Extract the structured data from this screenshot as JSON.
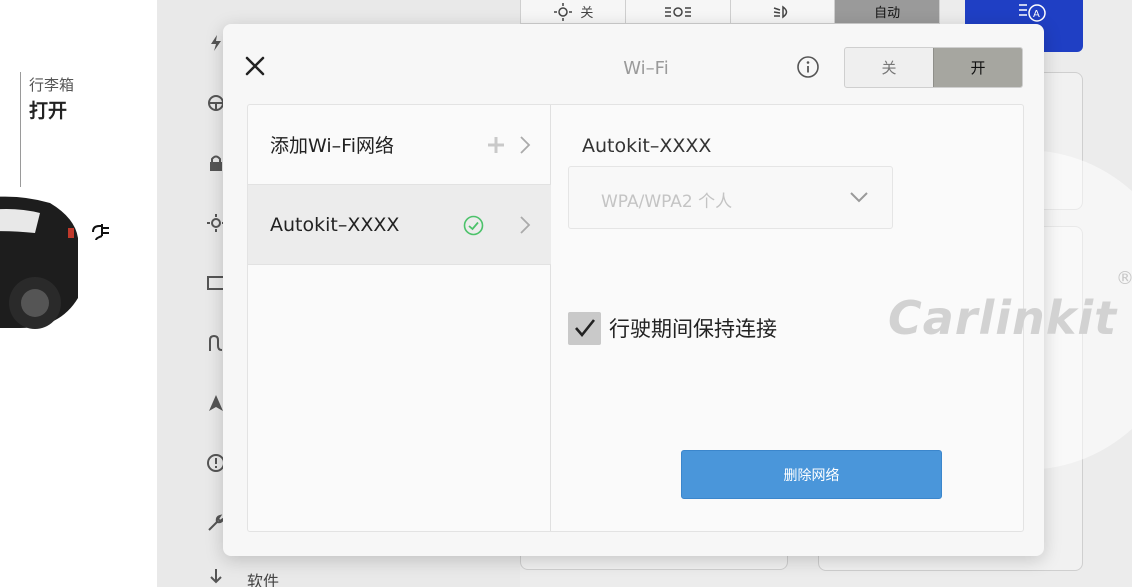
{
  "background": {
    "trunk": {
      "title": "行李箱",
      "value": "打开"
    },
    "nav_bottom_label": "软件",
    "lights": {
      "off_label": "关",
      "auto_label": "自动"
    }
  },
  "modal": {
    "title": "Wi–Fi",
    "toggle": {
      "off_label": "关",
      "on_label": "开",
      "selected": "on"
    },
    "list": {
      "add_label": "添加Wi–Fi网络",
      "networks": [
        {
          "name": "Autokit–XXXX",
          "connected": true
        }
      ]
    },
    "detail": {
      "network_name": "Autokit–XXXX",
      "security": "WPA/WPA2 个人",
      "keep_connected_label": "行驶期间保持连接",
      "keep_connected": true,
      "delete_label": "删除网络"
    },
    "watermark": "Carlinkit"
  },
  "colors": {
    "accent_blue": "#4a96da",
    "toggle_active": "#a6a6a0",
    "connected_green": "#4cc26a",
    "brand_blue": "#1f3fc4"
  },
  "icons": {
    "close": "close-icon",
    "info": "info-icon",
    "add": "plus-icon",
    "connected": "check-circle-icon",
    "chevron_right": "chevron-right-icon",
    "chevron_down": "chevron-down-icon"
  }
}
